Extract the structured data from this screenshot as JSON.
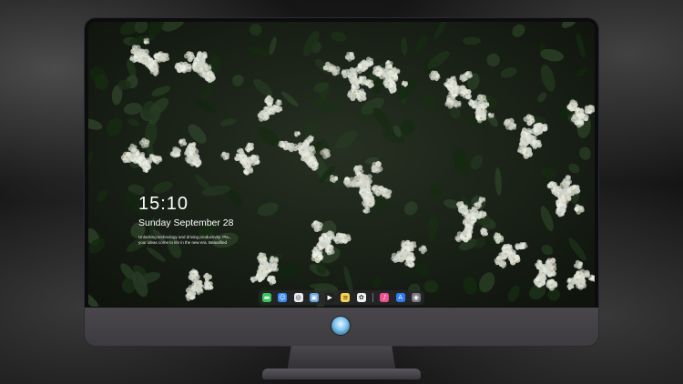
{
  "lockscreen": {
    "time": "15:10",
    "date": "Sunday September 28",
    "note_line1": "Unlocking technology and driving productivity. Pla...",
    "note_line2": "your ideas come to life in the new era. Beautified"
  },
  "dock": {
    "icons": [
      {
        "name": "messages-icon",
        "color": "#3ac55a",
        "glyph": "▬"
      },
      {
        "name": "finder-icon",
        "color": "#3a8df5",
        "glyph": "☺"
      },
      {
        "name": "safari-icon",
        "color": "#e9e9ee",
        "glyph": "◎"
      },
      {
        "name": "preview-icon",
        "color": "#6aa6d8",
        "glyph": "▣"
      },
      {
        "name": "finalcut-icon",
        "color": "#1f1f1f",
        "glyph": "▶"
      },
      {
        "name": "notes-icon",
        "color": "#f5d24a",
        "glyph": "≡"
      },
      {
        "name": "photos-icon",
        "color": "#f0f0f0",
        "glyph": "✿"
      },
      {
        "name": "music-icon",
        "color": "#f0508f",
        "glyph": "♪"
      },
      {
        "name": "appstore-icon",
        "color": "#2f7cf0",
        "glyph": "A"
      },
      {
        "name": "camera-icon",
        "color": "#7a7a80",
        "glyph": "◉"
      }
    ]
  },
  "colors": {
    "monitor_chin": "#444147",
    "screen_bg": "#1b2218",
    "flower": "#e8ece6"
  }
}
